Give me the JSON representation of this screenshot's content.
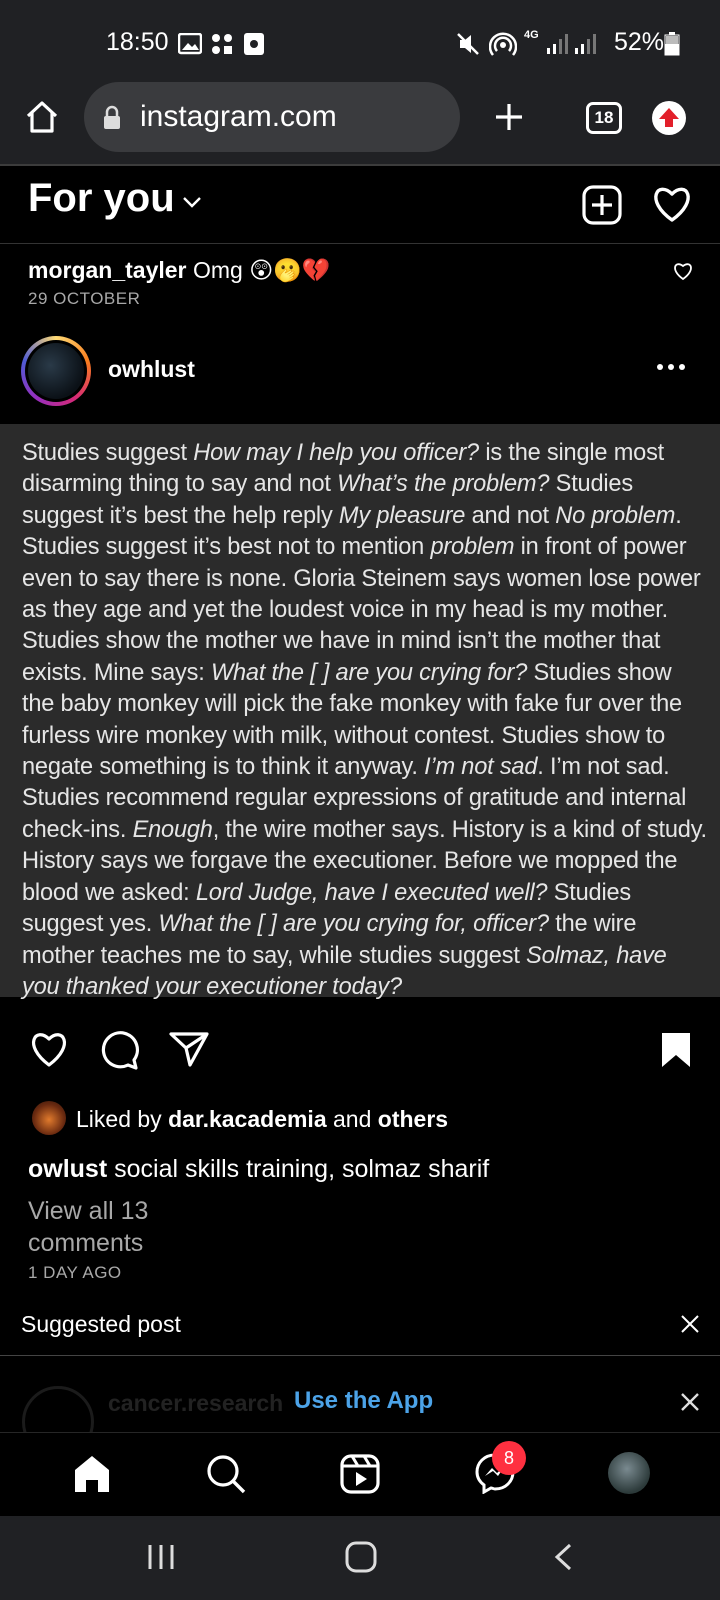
{
  "status_bar": {
    "time": "18:50",
    "battery": "52%",
    "network": "4G"
  },
  "browser": {
    "url": "instagram.com",
    "tab_count": "18"
  },
  "header": {
    "title": "For you"
  },
  "notification": {
    "username": "morgan_tayler",
    "text": "Omg 😲🫢💔",
    "date": "29 OCTOBER"
  },
  "post": {
    "username": "owhlust",
    "body_segments": [
      {
        "t": "Studies suggest ",
        "i": false
      },
      {
        "t": "How may I help you officer?",
        "i": true
      },
      {
        "t": " is the single most disarming thing to say and not ",
        "i": false
      },
      {
        "t": "What’s the problem?",
        "i": true
      },
      {
        "t": " Studies suggest it’s best the help reply ",
        "i": false
      },
      {
        "t": "My pleasure",
        "i": true
      },
      {
        "t": " and not ",
        "i": false
      },
      {
        "t": "No problem",
        "i": true
      },
      {
        "t": ". Studies suggest it’s best not to mention ",
        "i": false
      },
      {
        "t": "problem",
        "i": true
      },
      {
        "t": " in front of power even to say there is none. Gloria Steinem says women lose power as they age and yet the loudest voice in my head is my mother. Studies show the mother we have in mind isn’t the mother that exists. Mine says: ",
        "i": false
      },
      {
        "t": "What the [ ] are you crying for?",
        "i": true
      },
      {
        "t": " Studies show the baby monkey will pick the fake monkey with fake fur over the furless wire monkey with milk, without contest. Studies show to negate something is to think it anyway. ",
        "i": false
      },
      {
        "t": "I’m not sad",
        "i": true
      },
      {
        "t": ". I’m not sad. Studies recommend regular expressions of gratitude and internal check-ins. ",
        "i": false
      },
      {
        "t": "Enough",
        "i": true
      },
      {
        "t": ", the wire mother says. History is a kind of study. History says we forgave the executioner. Before we mopped the blood we asked: ",
        "i": false
      },
      {
        "t": "Lord Judge, have I executed well?",
        "i": true
      },
      {
        "t": " Studies suggest yes. ",
        "i": false
      },
      {
        "t": "What the [ ] are you crying for, officer?",
        "i": true
      },
      {
        "t": " the wire mother teaches me to say, while studies suggest ",
        "i": false
      },
      {
        "t": "Solmaz, have you thanked your executioner today?",
        "i": true
      }
    ],
    "likes": {
      "prefix": "Liked by ",
      "user": "dar.kacademia",
      "middle": " and ",
      "others": "others"
    },
    "caption_user": "owlust",
    "caption_text": " social skills training, solmaz sharif",
    "view_comments": "View all 13 comments",
    "time_ago": "1 DAY AGO"
  },
  "suggested": {
    "label": "Suggested post",
    "ghost_user": "cancer.research",
    "use_app": "Use the App"
  },
  "nav": {
    "dm_badge": "8"
  },
  "colors": {
    "status_bg": "#202124",
    "badge": "#ff3040",
    "link_blue": "#4ca3e8"
  }
}
